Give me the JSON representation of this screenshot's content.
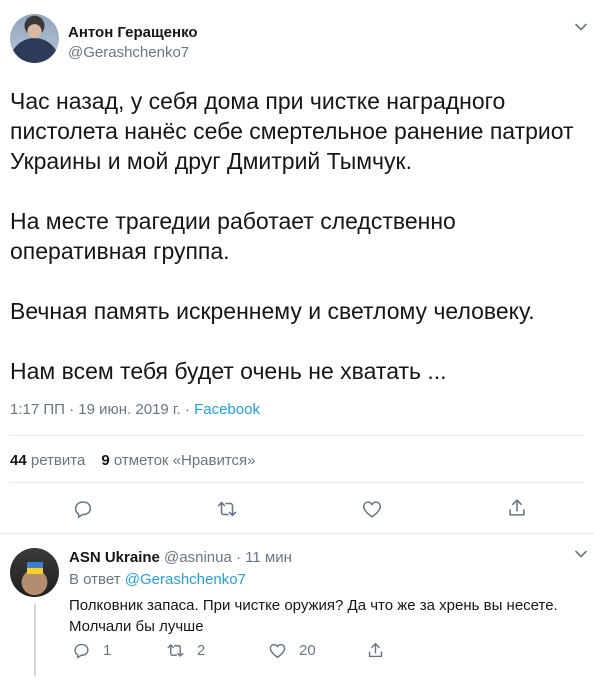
{
  "author": {
    "name": "Антон Геращенко",
    "handle": "@Gerashchenko7"
  },
  "tweet": {
    "paragraphs": [
      "Час назад, у себя дома при чистке наградного пистолета нанёс себе смертельное ранение патриот Украины и мой друг Дмитрий Тымчук.",
      "На месте трагедии работает следственно оперативная группа.",
      "Вечная память искреннему и светлому человеку.",
      "Нам всем тебя будет очень не хватать ..."
    ],
    "time": "1:17 ПП",
    "date": "19 июн. 2019 г.",
    "separator": "·",
    "source": "Facebook"
  },
  "stats": {
    "retweets_count": "44",
    "retweets_label": "ретвита",
    "likes_count": "9",
    "likes_label": "отметок «Нравится»"
  },
  "icons": {
    "reply": "reply-icon",
    "retweet": "retweet-icon",
    "like": "heart-icon",
    "share": "share-icon",
    "menu": "chevron-down-icon"
  },
  "colors": {
    "accent": "#1da1f2",
    "muted": "#657786",
    "text": "#14171a",
    "divider": "#e6ecf0"
  },
  "reply": {
    "name": "ASN Ukraine",
    "handle": "@asninua",
    "separator": "·",
    "time": "11 мин",
    "in_reply_prefix": "В ответ",
    "in_reply_mention": "@Gerashchenko7",
    "text": "Полковник запаса. При чистке оружия? Да что же за хрень вы несете. Молчали бы лучше",
    "reply_count": "1",
    "retweet_count": "2",
    "like_count": "20"
  }
}
